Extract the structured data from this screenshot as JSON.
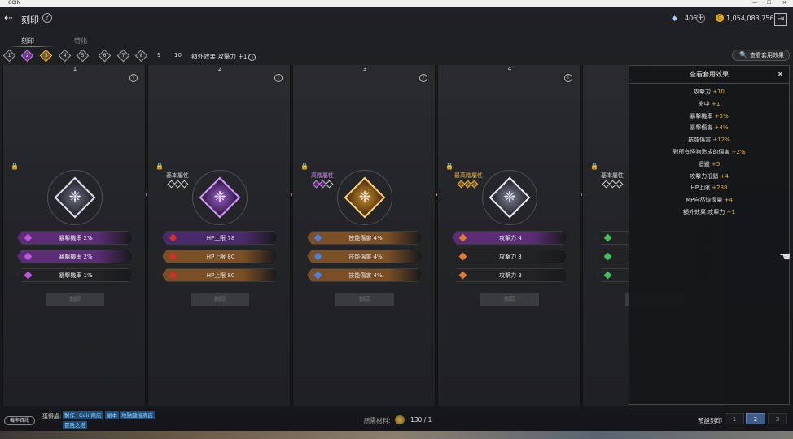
{
  "window": {
    "title": "COIN",
    "controls": [
      "—",
      "☐",
      "✕"
    ]
  },
  "header": {
    "back_icon": "arrow-left",
    "title": "刻印",
    "help": "?",
    "diamond": "406",
    "plus": "+",
    "coin_icon": "G",
    "gold": "1,054,083,756",
    "exit_icon": "exit"
  },
  "tabs": [
    {
      "label": "刻印",
      "active": true
    },
    {
      "label": "特化",
      "active": false
    }
  ],
  "steps": {
    "items": [
      "1",
      "2",
      "3",
      "4",
      "5",
      "6",
      "7",
      "8"
    ],
    "nine": "9",
    "ten": "10",
    "extra": "額外效果:攻擊力 +1",
    "info": "i"
  },
  "view_button": {
    "icon": "🔍",
    "label": "查看套用效果"
  },
  "cards": [
    {
      "num": "1",
      "info": "i",
      "lock": "🔒",
      "attr_label": "",
      "accent": "#a9b4d8",
      "stats": [
        {
          "text": "暴擊機率 2%",
          "color": "#c056e0"
        },
        {
          "text": "暴擊機率 2%",
          "color": "#c056e0"
        },
        {
          "text": "暴擊機率 1%",
          "color": "#c056e0"
        }
      ],
      "fill": [
        "#5b2d75",
        "#5b2d75",
        "#232326"
      ],
      "button": "刻印"
    },
    {
      "num": "2",
      "info": "i",
      "lock": "🔒",
      "attr_label": "基本屬性",
      "accent": "#b06ee0",
      "stats": [
        {
          "text": "HP上限 78",
          "color": "#d0312d"
        },
        {
          "text": "HP上限 80",
          "color": "#d0312d"
        },
        {
          "text": "HP上限 80",
          "color": "#d0312d"
        }
      ],
      "fill": [
        "#4a2a6a",
        "#7a4f25",
        "#7a4f25"
      ],
      "button": "刻印"
    },
    {
      "num": "3",
      "info": "i",
      "lock": "🔒",
      "attr_label": "高階屬性",
      "accent": "#e3a33c",
      "stats": [
        {
          "text": "技能傷害 4%",
          "color": "#4f7fe0"
        },
        {
          "text": "技能傷害 4%",
          "color": "#4f7fe0"
        },
        {
          "text": "技能傷害 4%",
          "color": "#4f7fe0"
        }
      ],
      "fill": [
        "#7a4f25",
        "#7a4f25",
        "#7a4f25"
      ],
      "button": "刻印"
    },
    {
      "num": "4",
      "info": "i",
      "lock": "🔒",
      "attr_label": "最高階屬性",
      "accent": "#c9c9d8",
      "stats": [
        {
          "text": "攻擊力 4",
          "color": "#e07b30"
        },
        {
          "text": "攻擊力 3",
          "color": "#e07b30"
        },
        {
          "text": "攻擊力 3",
          "color": "#e07b30"
        }
      ],
      "fill": [
        "#5b2d75",
        "#232326",
        "#232326"
      ],
      "button": "刻印"
    },
    {
      "num": "5",
      "info": "i",
      "lock": "🔒",
      "attr_label": "基本屬性",
      "accent": "#9aa",
      "stats": [
        {
          "text": "",
          "color": "#3fbf5a"
        },
        {
          "text": "",
          "color": "#3fbf5a"
        },
        {
          "text": "",
          "color": "#3fbf5a"
        }
      ],
      "fill": [
        "#232326",
        "#232326",
        "#232326"
      ],
      "button": "刻印"
    }
  ],
  "panel": {
    "title": "查看套用效果",
    "close": "✕",
    "rows": [
      {
        "name": "攻擊力",
        "val": "+10"
      },
      {
        "name": "命中",
        "val": "+1"
      },
      {
        "name": "暴擊機率",
        "val": "+5%"
      },
      {
        "name": "暴擊傷害",
        "val": "+4%"
      },
      {
        "name": "技能傷害",
        "val": "+12%"
      },
      {
        "name": "對所有怪物造成的傷害",
        "val": "+2%"
      },
      {
        "name": "迴避",
        "val": "+5"
      },
      {
        "name": "攻擊力抵銷",
        "val": "+4"
      },
      {
        "name": "HP上限",
        "val": "+238"
      },
      {
        "name": "MP自然恢復量",
        "val": "+4"
      },
      {
        "name": "額外效果:攻擊力",
        "val": "+1"
      }
    ]
  },
  "footer": {
    "prob": "機率資訊",
    "obtain": "獲得處:",
    "tags": [
      "製作",
      "Coin商店",
      "副本",
      "地點鏈接商店",
      "冒險之塔"
    ],
    "mat_label": "所需材料:",
    "mat_value": "130 / 1",
    "preset_label": "預設刻印",
    "presets": [
      "1",
      "2",
      "3"
    ],
    "active_preset": "2"
  }
}
